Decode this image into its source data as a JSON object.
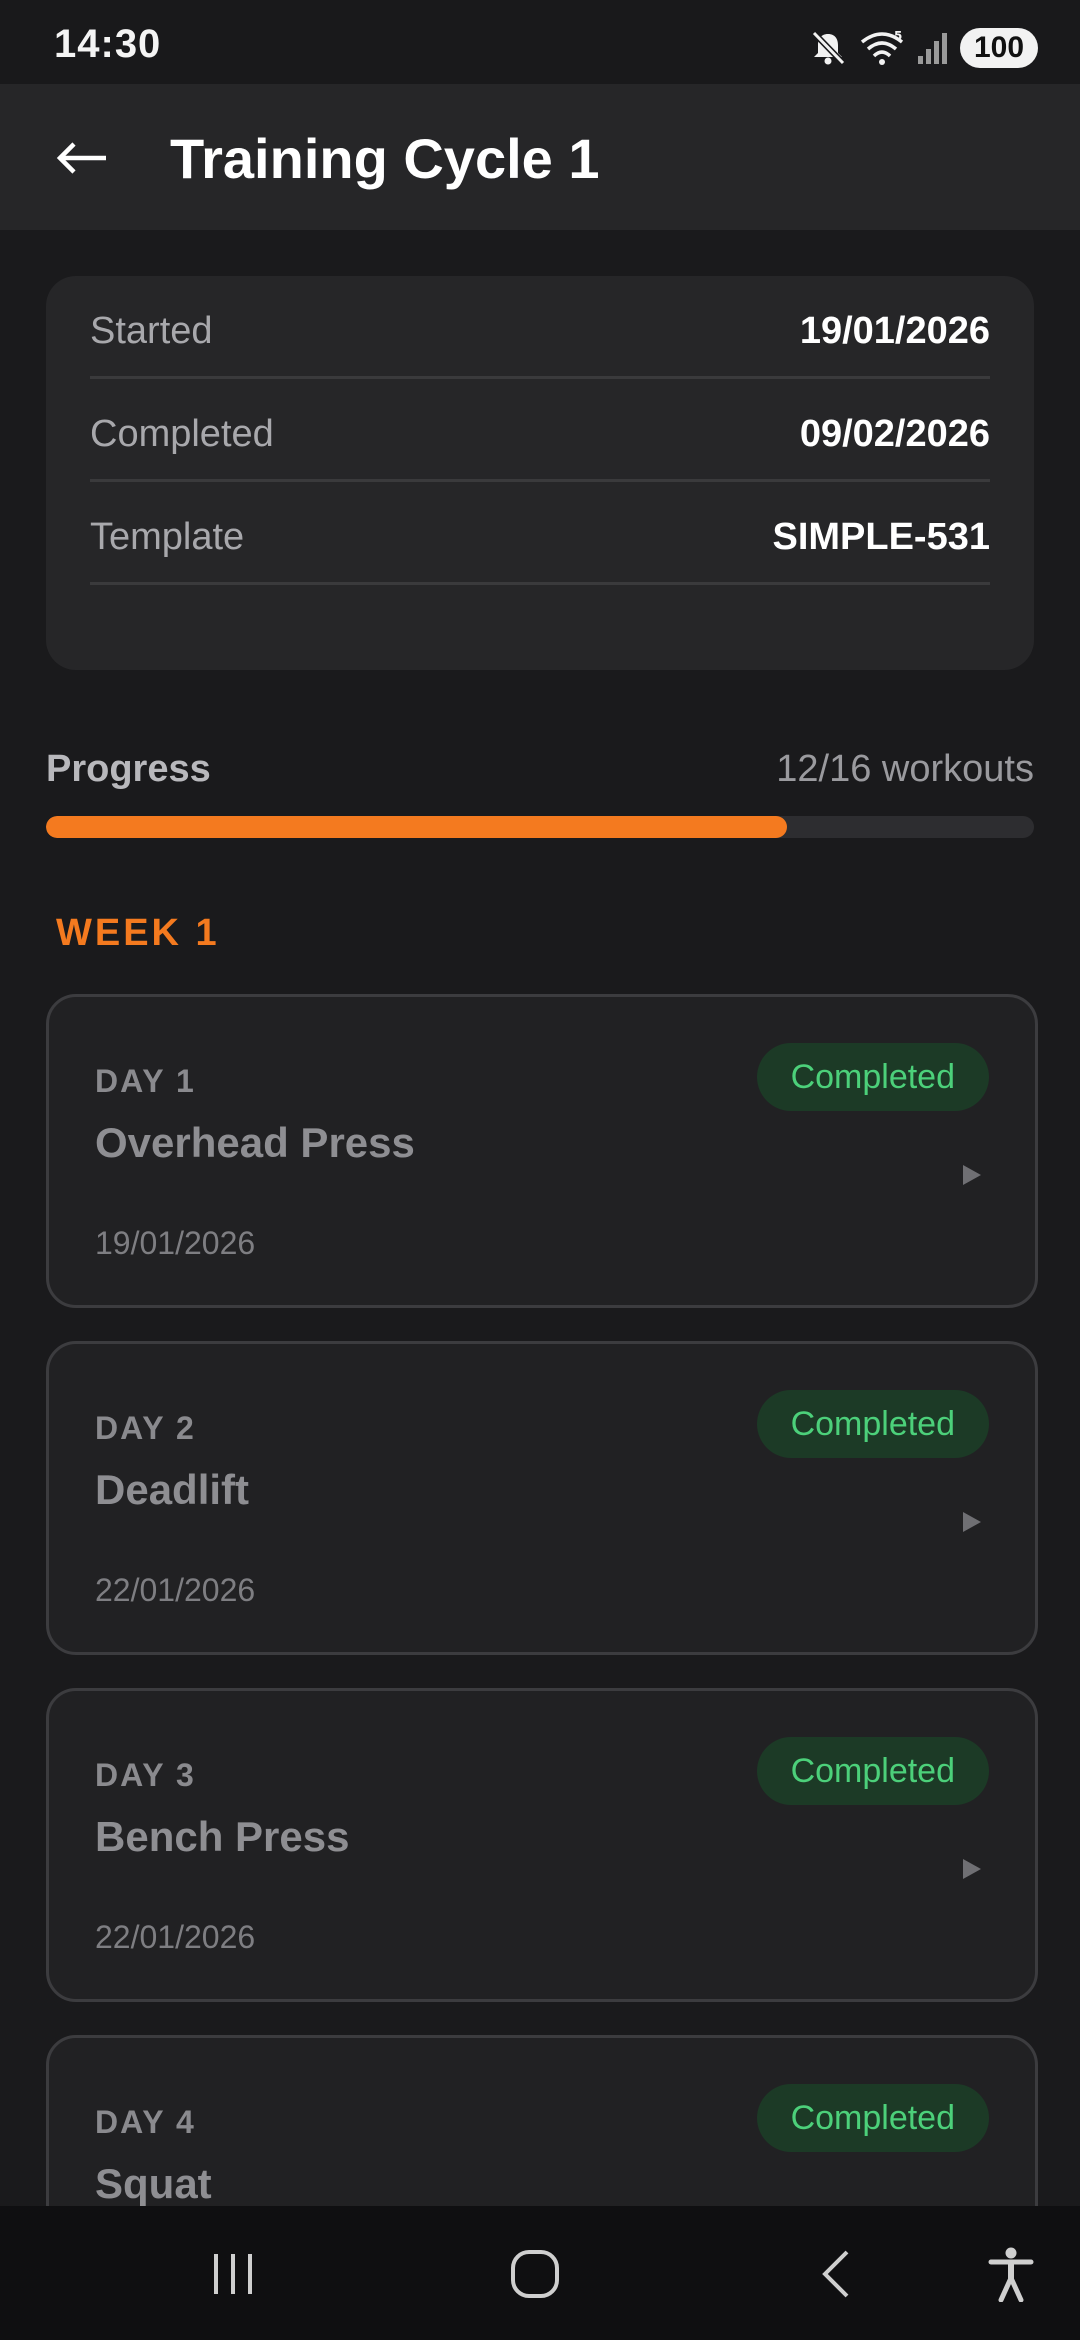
{
  "status_bar": {
    "time": "14:30",
    "battery": "100",
    "icons": [
      "mute-icon",
      "wifi-icon",
      "signal-icon"
    ]
  },
  "app_bar": {
    "title": "Training Cycle 1",
    "back_icon": "back-arrow-icon"
  },
  "info": {
    "rows": [
      {
        "label": "Started",
        "value": "19/01/2026"
      },
      {
        "label": "Completed",
        "value": "09/02/2026"
      },
      {
        "label": "Template",
        "value": "SIMPLE-531"
      }
    ]
  },
  "progress": {
    "label": "Progress",
    "count_text": "12/16 workouts",
    "fraction": 0.75
  },
  "week": {
    "title": "WEEK 1"
  },
  "days": [
    {
      "day": "DAY 1",
      "exercise": "Overhead Press",
      "date": "19/01/2026",
      "status": "Completed"
    },
    {
      "day": "DAY 2",
      "exercise": "Deadlift",
      "date": "22/01/2026",
      "status": "Completed"
    },
    {
      "day": "DAY 3",
      "exercise": "Bench Press",
      "date": "22/01/2026",
      "status": "Completed"
    },
    {
      "day": "DAY 4",
      "exercise": "Squat",
      "status": "Completed"
    }
  ],
  "colors": {
    "accent": "#f47a1f",
    "completed_text": "#4cd07a",
    "completed_bg": "#1c3a26",
    "background": "#1a1a1c",
    "card": "#262628"
  },
  "nav_bar": {
    "icons": [
      "recent-apps-icon",
      "home-icon",
      "back-icon",
      "accessibility-icon"
    ]
  }
}
